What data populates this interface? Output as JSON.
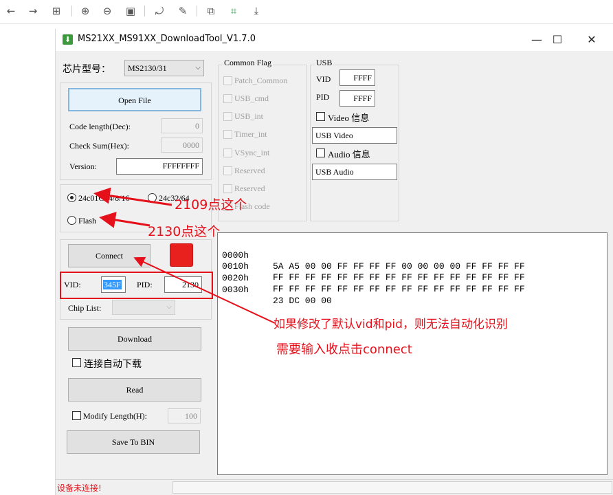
{
  "viewer_toolbar": {
    "icons": [
      "back-arrow-icon",
      "forward-arrow-icon",
      "grid-icon",
      "zoom-in-icon",
      "zoom-out-icon",
      "actual-size-icon",
      "rotate-icon",
      "edit-icon",
      "crop-icon",
      "ocr-icon",
      "download-icon"
    ],
    "glyphs": [
      "←",
      "→",
      "⊞",
      "⊕",
      "⊖",
      "▣",
      "⤾",
      "✎",
      "⧉",
      "⌗",
      "⤓"
    ]
  },
  "window": {
    "title": "MS21XX_MS91XX_DownloadTool_V1.7.0",
    "minimize": "—",
    "maximize": "☐",
    "close": "✕"
  },
  "chip": {
    "label": "芯片型号：",
    "value": "MS2130/31"
  },
  "file_group": {
    "open_file": "Open File",
    "code_length_label": "Code length(Dec):",
    "code_length_value": "0",
    "check_sum_label": "Check Sum(Hex):",
    "check_sum_value": "0000",
    "version_label": "Version:",
    "version_value": "FFFFFFFF"
  },
  "memory_group": {
    "opt1": "24c01C~4/8/16",
    "opt2": "24c32/64",
    "opt3": "Flash"
  },
  "connect_group": {
    "connect": "Connect",
    "status_color": "#e8211f",
    "vid_label": "VID:",
    "vid_value": "345F",
    "pid_label": "PID:",
    "pid_value": "2130",
    "chip_list_label": "Chip List:",
    "chip_list_value": ""
  },
  "actions": {
    "download": "Download",
    "auto_download": "连接自动下载",
    "read": "Read",
    "modify_length": "Modify  Length(H):",
    "modify_length_value": "100",
    "save_to_bin": "Save To BIN"
  },
  "common_flag": {
    "title": "Common Flag",
    "items": [
      "Patch_Common",
      "USB_cmd",
      "USB_int",
      "Timer_int",
      "VSync_int",
      "Reserved",
      "Reserved",
      "Flash code"
    ]
  },
  "usb": {
    "title": "USB",
    "vid_label": "VID",
    "vid_value": "FFFF",
    "pid_label": "PID",
    "pid_value": "FFFF",
    "video_label": "Video 信息",
    "video_value": "USB Video",
    "audio_label": "Audio 信息",
    "audio_value": "USB Audio"
  },
  "hex_dump": [
    {
      "addr": "0000h",
      "bytes": "5A A5 00 00 FF FF FF FF 00 00 00 00 FF FF FF FF"
    },
    {
      "addr": "0010h",
      "bytes": "FF FF FF FF FF FF FF FF FF FF FF FF FF FF FF FF"
    },
    {
      "addr": "0020h",
      "bytes": "FF FF FF FF FF FF FF FF FF FF FF FF FF FF FF FF"
    },
    {
      "addr": "0030h",
      "bytes": "23 DC 00 00"
    }
  ],
  "status_bar": {
    "text": "设备未连接!"
  },
  "annotations": {
    "note_2109": "2109点这个",
    "note_2130": "2130点这个",
    "note_vidpid_1": "如果修改了默认vid和pid，则无法自动化识别",
    "note_vidpid_2": "需要输入收点击connect",
    "color": "#e5101a"
  }
}
